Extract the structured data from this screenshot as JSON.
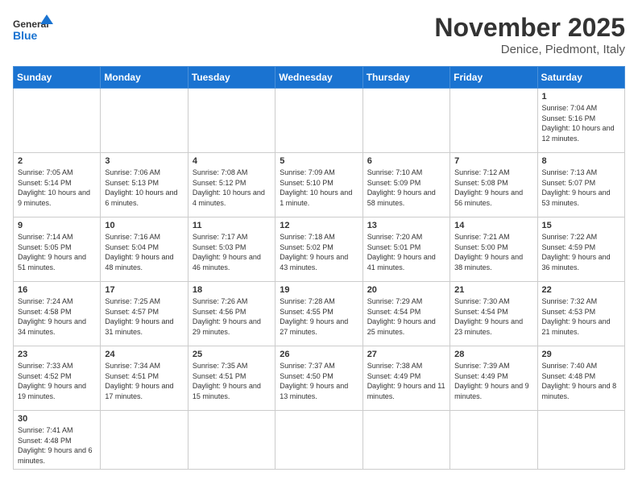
{
  "header": {
    "logo_general": "General",
    "logo_blue": "Blue",
    "month_title": "November 2025",
    "subtitle": "Denice, Piedmont, Italy"
  },
  "days_of_week": [
    "Sunday",
    "Monday",
    "Tuesday",
    "Wednesday",
    "Thursday",
    "Friday",
    "Saturday"
  ],
  "weeks": [
    [
      {
        "day": "",
        "info": ""
      },
      {
        "day": "",
        "info": ""
      },
      {
        "day": "",
        "info": ""
      },
      {
        "day": "",
        "info": ""
      },
      {
        "day": "",
        "info": ""
      },
      {
        "day": "",
        "info": ""
      },
      {
        "day": "1",
        "info": "Sunrise: 7:04 AM\nSunset: 5:16 PM\nDaylight: 10 hours and 12 minutes."
      }
    ],
    [
      {
        "day": "2",
        "info": "Sunrise: 7:05 AM\nSunset: 5:14 PM\nDaylight: 10 hours and 9 minutes."
      },
      {
        "day": "3",
        "info": "Sunrise: 7:06 AM\nSunset: 5:13 PM\nDaylight: 10 hours and 6 minutes."
      },
      {
        "day": "4",
        "info": "Sunrise: 7:08 AM\nSunset: 5:12 PM\nDaylight: 10 hours and 4 minutes."
      },
      {
        "day": "5",
        "info": "Sunrise: 7:09 AM\nSunset: 5:10 PM\nDaylight: 10 hours and 1 minute."
      },
      {
        "day": "6",
        "info": "Sunrise: 7:10 AM\nSunset: 5:09 PM\nDaylight: 9 hours and 58 minutes."
      },
      {
        "day": "7",
        "info": "Sunrise: 7:12 AM\nSunset: 5:08 PM\nDaylight: 9 hours and 56 minutes."
      },
      {
        "day": "8",
        "info": "Sunrise: 7:13 AM\nSunset: 5:07 PM\nDaylight: 9 hours and 53 minutes."
      }
    ],
    [
      {
        "day": "9",
        "info": "Sunrise: 7:14 AM\nSunset: 5:05 PM\nDaylight: 9 hours and 51 minutes."
      },
      {
        "day": "10",
        "info": "Sunrise: 7:16 AM\nSunset: 5:04 PM\nDaylight: 9 hours and 48 minutes."
      },
      {
        "day": "11",
        "info": "Sunrise: 7:17 AM\nSunset: 5:03 PM\nDaylight: 9 hours and 46 minutes."
      },
      {
        "day": "12",
        "info": "Sunrise: 7:18 AM\nSunset: 5:02 PM\nDaylight: 9 hours and 43 minutes."
      },
      {
        "day": "13",
        "info": "Sunrise: 7:20 AM\nSunset: 5:01 PM\nDaylight: 9 hours and 41 minutes."
      },
      {
        "day": "14",
        "info": "Sunrise: 7:21 AM\nSunset: 5:00 PM\nDaylight: 9 hours and 38 minutes."
      },
      {
        "day": "15",
        "info": "Sunrise: 7:22 AM\nSunset: 4:59 PM\nDaylight: 9 hours and 36 minutes."
      }
    ],
    [
      {
        "day": "16",
        "info": "Sunrise: 7:24 AM\nSunset: 4:58 PM\nDaylight: 9 hours and 34 minutes."
      },
      {
        "day": "17",
        "info": "Sunrise: 7:25 AM\nSunset: 4:57 PM\nDaylight: 9 hours and 31 minutes."
      },
      {
        "day": "18",
        "info": "Sunrise: 7:26 AM\nSunset: 4:56 PM\nDaylight: 9 hours and 29 minutes."
      },
      {
        "day": "19",
        "info": "Sunrise: 7:28 AM\nSunset: 4:55 PM\nDaylight: 9 hours and 27 minutes."
      },
      {
        "day": "20",
        "info": "Sunrise: 7:29 AM\nSunset: 4:54 PM\nDaylight: 9 hours and 25 minutes."
      },
      {
        "day": "21",
        "info": "Sunrise: 7:30 AM\nSunset: 4:54 PM\nDaylight: 9 hours and 23 minutes."
      },
      {
        "day": "22",
        "info": "Sunrise: 7:32 AM\nSunset: 4:53 PM\nDaylight: 9 hours and 21 minutes."
      }
    ],
    [
      {
        "day": "23",
        "info": "Sunrise: 7:33 AM\nSunset: 4:52 PM\nDaylight: 9 hours and 19 minutes."
      },
      {
        "day": "24",
        "info": "Sunrise: 7:34 AM\nSunset: 4:51 PM\nDaylight: 9 hours and 17 minutes."
      },
      {
        "day": "25",
        "info": "Sunrise: 7:35 AM\nSunset: 4:51 PM\nDaylight: 9 hours and 15 minutes."
      },
      {
        "day": "26",
        "info": "Sunrise: 7:37 AM\nSunset: 4:50 PM\nDaylight: 9 hours and 13 minutes."
      },
      {
        "day": "27",
        "info": "Sunrise: 7:38 AM\nSunset: 4:49 PM\nDaylight: 9 hours and 11 minutes."
      },
      {
        "day": "28",
        "info": "Sunrise: 7:39 AM\nSunset: 4:49 PM\nDaylight: 9 hours and 9 minutes."
      },
      {
        "day": "29",
        "info": "Sunrise: 7:40 AM\nSunset: 4:48 PM\nDaylight: 9 hours and 8 minutes."
      }
    ],
    [
      {
        "day": "30",
        "info": "Sunrise: 7:41 AM\nSunset: 4:48 PM\nDaylight: 9 hours and 6 minutes."
      },
      {
        "day": "",
        "info": ""
      },
      {
        "day": "",
        "info": ""
      },
      {
        "day": "",
        "info": ""
      },
      {
        "day": "",
        "info": ""
      },
      {
        "day": "",
        "info": ""
      },
      {
        "day": "",
        "info": ""
      }
    ]
  ]
}
